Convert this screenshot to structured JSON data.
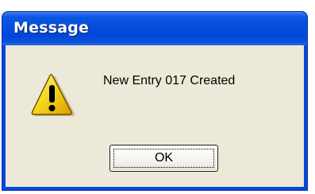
{
  "window": {
    "title": "Message"
  },
  "dialog": {
    "icon": "warning-icon",
    "message": "New Entry 017 Created",
    "ok_label": "OK"
  },
  "colors": {
    "title_bar": "#0650dc",
    "client_background": "#ece9d8",
    "warning_fill": "#f8d820"
  }
}
